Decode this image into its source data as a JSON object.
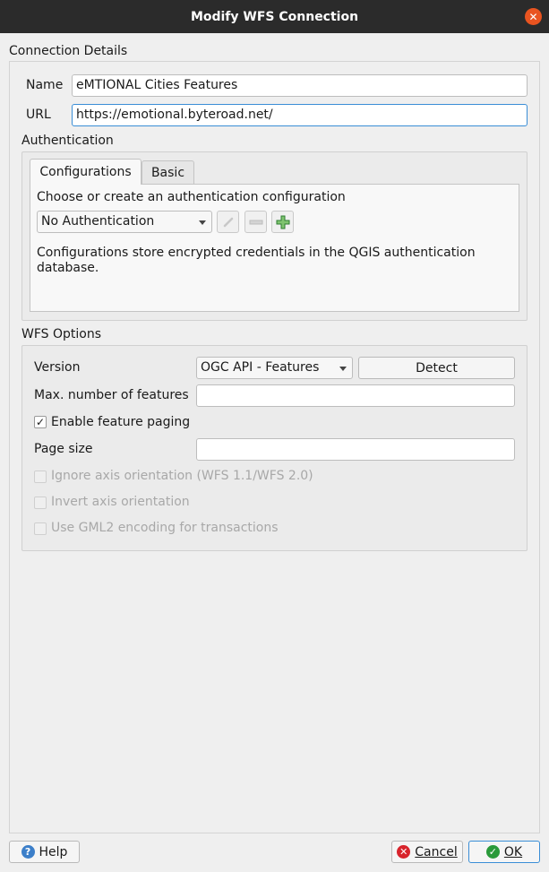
{
  "window": {
    "title": "Modify WFS Connection",
    "close_glyph": "✕"
  },
  "connection": {
    "section_label": "Connection Details",
    "name_label": "Name",
    "name_value": "eMTIONAL Cities Features",
    "url_label": "URL",
    "url_value": "https://emotional.byteroad.net/"
  },
  "authentication": {
    "section_label": "Authentication",
    "tabs": [
      {
        "label": "Configurations",
        "active": true
      },
      {
        "label": "Basic",
        "active": false
      }
    ],
    "choose_label": "Choose or create an authentication configuration",
    "config_selected": "No Authentication",
    "info_text": "Configurations store encrypted credentials in the QGIS authentication database."
  },
  "wfs_options": {
    "section_label": "WFS Options",
    "version_label": "Version",
    "version_selected": "OGC API - Features",
    "detect_label": "Detect",
    "max_features_label": "Max. number of features",
    "max_features_value": "",
    "enable_paging_label": "Enable feature paging",
    "enable_paging_checked": true,
    "check_glyph": "✓",
    "page_size_label": "Page size",
    "page_size_value": "",
    "ignore_axis_label": "Ignore axis orientation (WFS 1.1/WFS 2.0)",
    "invert_axis_label": "Invert axis orientation",
    "gml2_label": "Use GML2 encoding for transactions"
  },
  "footer": {
    "help_label": "Help",
    "help_glyph": "?",
    "cancel_label": "Cancel",
    "cancel_glyph": "✕",
    "ok_label": "OK",
    "ok_glyph": "✓"
  },
  "colors": {
    "titlebar": "#2b2b2b",
    "close": "#e95420",
    "focus": "#3a8ed6",
    "help_icon": "#3c7fc9",
    "cancel_icon": "#d8242c",
    "ok_icon": "#2a9a3a"
  }
}
